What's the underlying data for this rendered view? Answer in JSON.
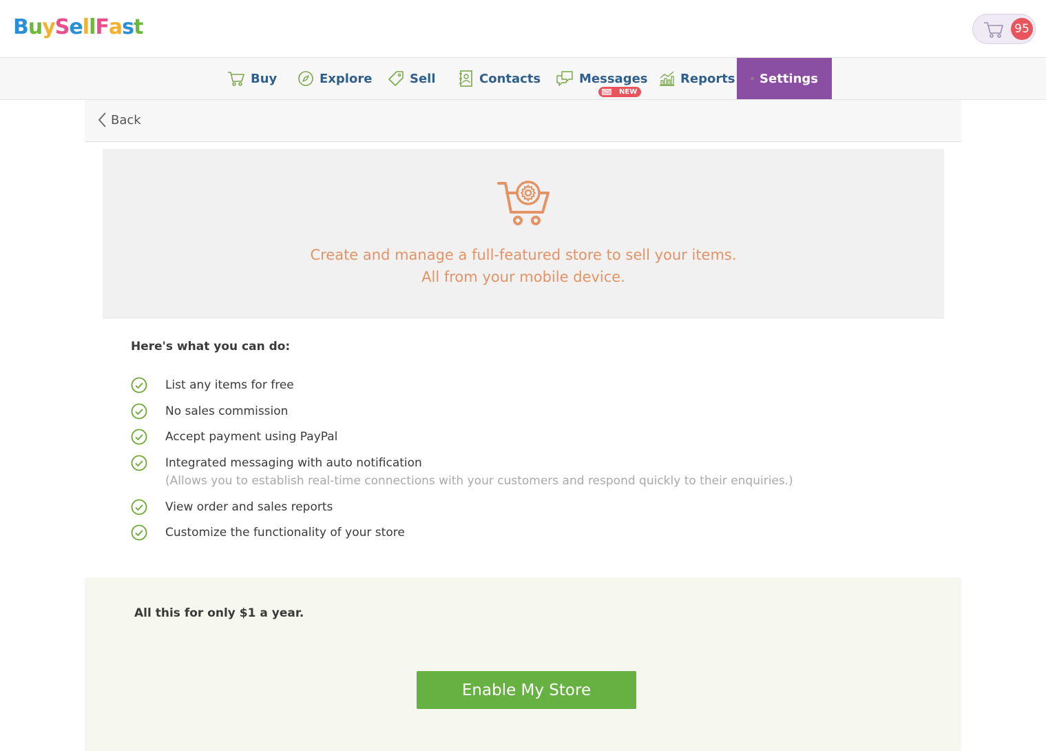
{
  "header": {
    "logo_text": "BuySellFast",
    "cart_count": "95"
  },
  "nav": {
    "items": [
      {
        "label": "Buy",
        "icon": "cart-icon"
      },
      {
        "label": "Explore",
        "icon": "compass-icon"
      },
      {
        "label": "Sell",
        "icon": "tag-icon"
      },
      {
        "label": "Contacts",
        "icon": "address-book-icon"
      },
      {
        "label": "Messages",
        "icon": "chat-icon",
        "badge": "NEW"
      },
      {
        "label": "Reports",
        "icon": "bar-chart-icon"
      },
      {
        "label": "Settings",
        "icon": "gear-icon",
        "active": true
      }
    ]
  },
  "back": {
    "label": "Back"
  },
  "hero": {
    "line1": "Create and manage a full-featured store to sell your items.",
    "line2": "All from your mobile device."
  },
  "features": {
    "title": "Here's what you can do:",
    "items": [
      {
        "text": "List any items for free"
      },
      {
        "text": "No sales commission"
      },
      {
        "text": "Accept payment using PayPal"
      },
      {
        "text": "Integrated messaging with auto notification",
        "note": "(Allows you to establish real-time connections with your customers and respond quickly to their enquiries.)"
      },
      {
        "text": "View order and sales reports"
      },
      {
        "text": "Customize the functionality of your store"
      }
    ]
  },
  "pricing": {
    "text": "All this for only $1 a year.",
    "button_label": "Enable My Store"
  },
  "colors": {
    "accent_purple": "#8a4fa3",
    "nav_blue": "#2f5f8a",
    "green": "#67b042",
    "hero_orange": "#e39366",
    "badge_red": "#e8555c"
  }
}
